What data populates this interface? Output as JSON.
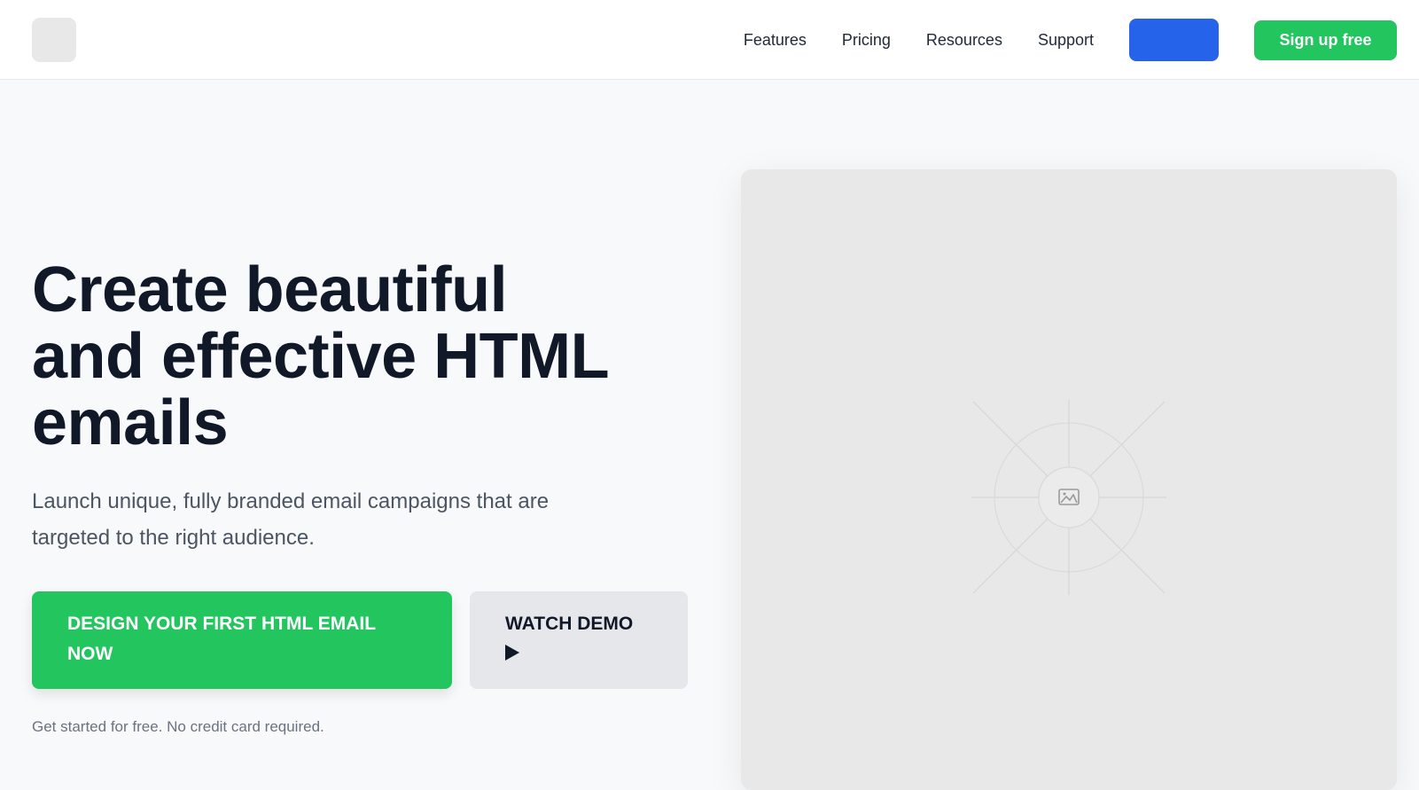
{
  "header": {
    "nav": [
      "Features",
      "Pricing",
      "Resources",
      "Support"
    ],
    "blue_button_label": "",
    "signup_label": "Sign up free"
  },
  "hero": {
    "title_lines": [
      "Create beautiful",
      "and effective HTML",
      "emails"
    ],
    "subtitle_lines": [
      "Launch unique, fully branded email campaigns that are",
      "targeted to the right audience."
    ],
    "primary_cta_lines": [
      "DESIGN YOUR FIRST HTML EMAIL",
      "NOW"
    ],
    "secondary_cta_label": "WATCH DEMO",
    "fine_print": "Get started for free. No credit card required."
  },
  "icons": {
    "logo": "logo-placeholder",
    "play": "play-icon",
    "image_placeholder": "image-icon"
  },
  "colors": {
    "accent_green": "#22c55e",
    "accent_blue": "#2563eb",
    "heading": "#111827",
    "body_text": "#4b5563",
    "muted_text": "#6b7280",
    "page_bg": "#f8f9fa",
    "placeholder_bg": "#e8e8e8"
  }
}
